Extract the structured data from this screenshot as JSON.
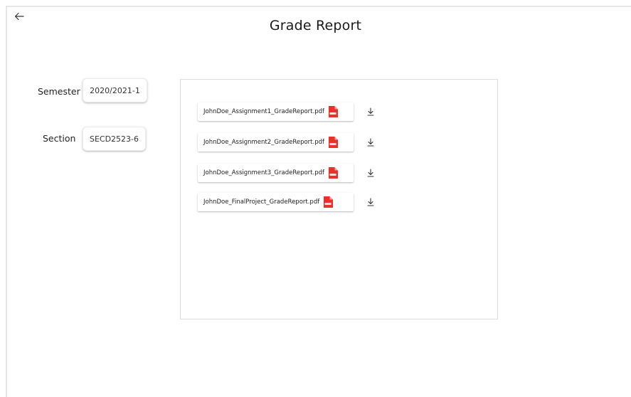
{
  "header": {
    "title": "Grade Report",
    "back_icon": "arrow-left-icon"
  },
  "filters": {
    "semester": {
      "label": "Semester",
      "value": "2020/2021-1"
    },
    "section": {
      "label": "Section",
      "value": "SECD2523-6"
    }
  },
  "files": [
    {
      "name": "JohnDoe_Assignment1_GradeReport.pdf",
      "icon": "pdf-icon",
      "action_icon": "download-icon"
    },
    {
      "name": "JohnDoe_Assignment2_GradeReport.pdf",
      "icon": "pdf-icon",
      "action_icon": "download-icon"
    },
    {
      "name": "JohnDoe_Assignment3_GradeReport.pdf",
      "icon": "pdf-icon",
      "action_icon": "download-icon"
    },
    {
      "name": "JohnDoe_FinalProject_GradeReport.pdf",
      "icon": "pdf-icon",
      "action_icon": "download-icon"
    }
  ],
  "colors": {
    "pdf_red": "#e8312a",
    "border": "#dcdcdc"
  }
}
